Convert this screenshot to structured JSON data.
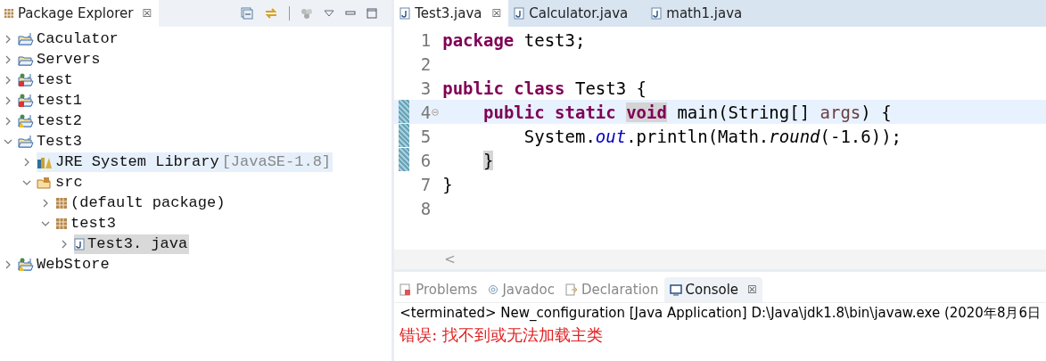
{
  "package_explorer": {
    "title": "Package Explorer",
    "close": "☒",
    "tree": [
      {
        "label": "Caculator",
        "kind": "project",
        "expanded": false,
        "selected": false,
        "highlighted": false
      },
      {
        "label": "Servers",
        "kind": "folder",
        "expanded": false,
        "selected": false,
        "highlighted": false
      },
      {
        "label": "test",
        "kind": "error-project",
        "expanded": false,
        "selected": false,
        "highlighted": false
      },
      {
        "label": "test1",
        "kind": "error-project",
        "expanded": false,
        "selected": false,
        "highlighted": false
      },
      {
        "label": "test2",
        "kind": "warn-project",
        "expanded": false,
        "selected": false,
        "highlighted": false
      },
      {
        "label": "Test3",
        "kind": "project",
        "expanded": true,
        "selected": false,
        "highlighted": false,
        "children": [
          {
            "label": "JRE System Library",
            "decoration": "[JavaSE-1.8]",
            "kind": "library",
            "expanded": false,
            "selected": false,
            "highlighted": true
          },
          {
            "label": "src",
            "kind": "source-folder",
            "expanded": true,
            "selected": false,
            "highlighted": false,
            "children": [
              {
                "label": "(default package)",
                "kind": "package",
                "expanded": false,
                "selected": false,
                "highlighted": false
              },
              {
                "label": "test3",
                "kind": "package",
                "expanded": true,
                "selected": false,
                "highlighted": false,
                "children": [
                  {
                    "label": "Test3. java",
                    "kind": "java-file",
                    "expanded": false,
                    "selected": true,
                    "highlighted": false
                  }
                ]
              }
            ]
          }
        ]
      },
      {
        "label": "WebStore",
        "kind": "warn-project",
        "expanded": false,
        "selected": false,
        "highlighted": false
      }
    ]
  },
  "editor": {
    "tabs": [
      {
        "label": "Test3.java",
        "close": "☒",
        "selected": true
      },
      {
        "label": "Calculator.java",
        "selected": false
      },
      {
        "label": "math1.java",
        "selected": false
      }
    ],
    "lines": [
      {
        "number": "1",
        "current": false,
        "changed": false,
        "foldable": false,
        "tokens": [
          {
            "text": "package",
            "kind": "keyword"
          },
          {
            "text": " test3;",
            "kind": "plain"
          }
        ]
      },
      {
        "number": "2",
        "current": false,
        "changed": false,
        "foldable": false
      },
      {
        "number": "3",
        "current": false,
        "changed": false,
        "foldable": false,
        "tokens": [
          {
            "text": "public class",
            "kind": "keyword"
          },
          {
            "text": " Test3 {",
            "kind": "plain"
          }
        ]
      },
      {
        "number": "4",
        "current": true,
        "changed": true,
        "foldable": true,
        "tokens": [
          {
            "text": "    public static ",
            "kind": "keyword"
          },
          {
            "text": "void",
            "kind": "keyword-match"
          },
          {
            "text": " main(String[] ",
            "kind": "plain"
          },
          {
            "text": "args",
            "kind": "param"
          },
          {
            "text": ") {",
            "kind": "plain"
          }
        ]
      },
      {
        "number": "5",
        "current": false,
        "changed": true,
        "foldable": false,
        "tokens": [
          {
            "text": "        System.",
            "kind": "plain"
          },
          {
            "text": "out",
            "kind": "field"
          },
          {
            "text": ".println(Math.",
            "kind": "plain"
          },
          {
            "text": "round",
            "kind": "method"
          },
          {
            "text": "(-1.6));",
            "kind": "plain"
          }
        ]
      },
      {
        "number": "6",
        "current": false,
        "changed": true,
        "foldable": false,
        "tokens": [
          {
            "text": "    }",
            "kind": "bracket-match"
          }
        ]
      },
      {
        "number": "7",
        "current": false,
        "changed": false,
        "foldable": false,
        "tokens": [
          {
            "text": "}",
            "kind": "plain"
          }
        ]
      },
      {
        "number": "8",
        "current": false,
        "changed": false,
        "foldable": false
      }
    ],
    "scroll_arrow": "<"
  },
  "bottom_panel": {
    "tabs": [
      {
        "label": "Problems",
        "selected": false
      },
      {
        "label": "Javadoc",
        "selected": false
      },
      {
        "label": "Declaration",
        "selected": false
      },
      {
        "label": "Console",
        "close": "☒",
        "selected": true
      }
    ],
    "console_lines": [
      {
        "text": "<terminated> New_configuration [Java Application] D:\\Java\\jdk1.8\\bin\\javaw.exe (2020年8月6日",
        "kind": "header"
      },
      {
        "text": "错误: 找不到或无法加载主类",
        "kind": "error"
      }
    ]
  }
}
